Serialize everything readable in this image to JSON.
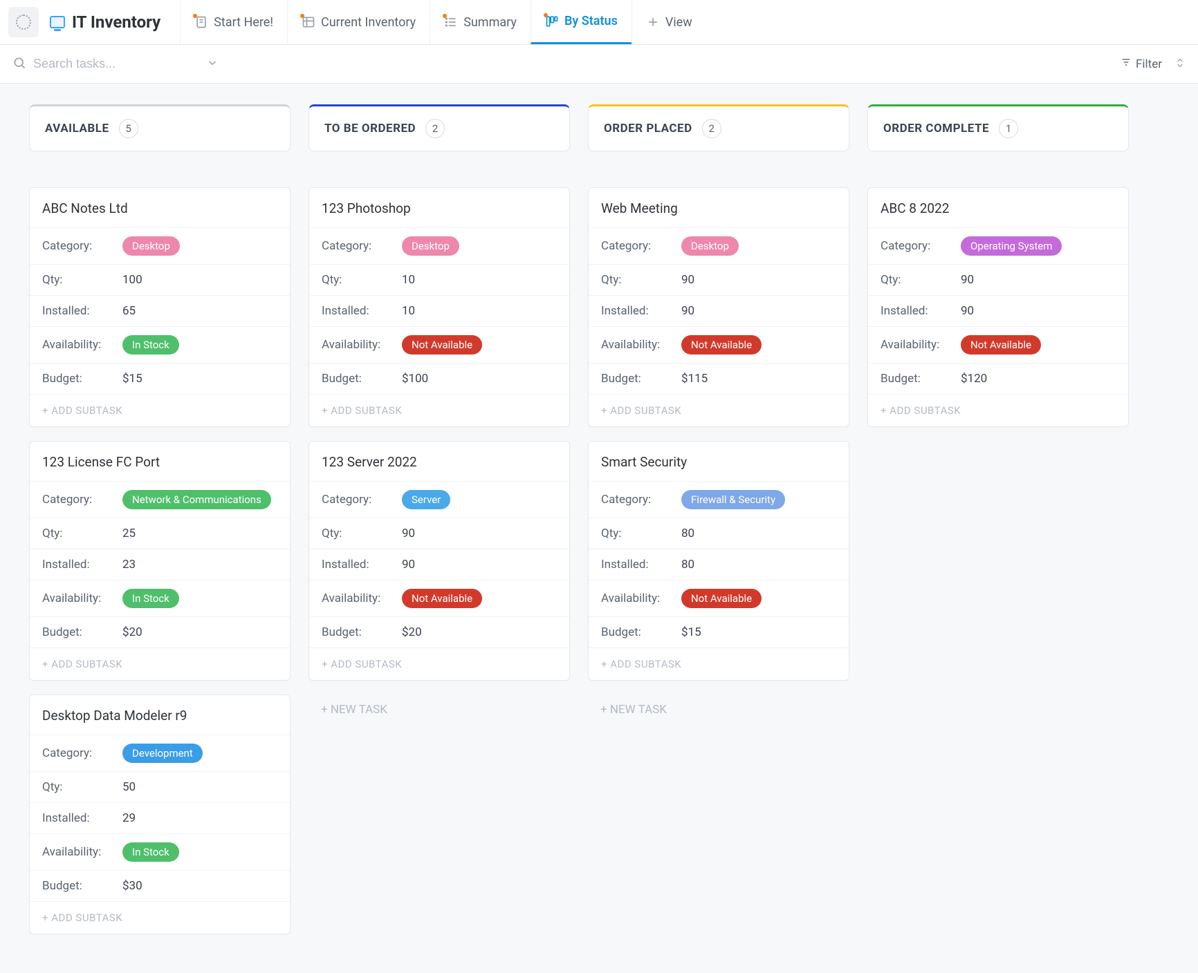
{
  "header": {
    "title": "IT Inventory",
    "tabs": [
      {
        "label": "Start Here!",
        "active": false
      },
      {
        "label": "Current Inventory",
        "active": false
      },
      {
        "label": "Summary",
        "active": false
      },
      {
        "label": "By Status",
        "active": true
      },
      {
        "label": "View",
        "active": false,
        "is_add": true
      }
    ]
  },
  "search": {
    "placeholder": "Search tasks..."
  },
  "toolbar": {
    "filter_label": "Filter"
  },
  "field_labels": {
    "category": "Category:",
    "qty": "Qty:",
    "installed": "Installed:",
    "availability": "Availability:",
    "budget": "Budget:"
  },
  "actions": {
    "add_subtask": "+ ADD SUBTASK",
    "new_task": "+ NEW TASK"
  },
  "columns": [
    {
      "title": "AVAILABLE",
      "count": "5",
      "accent": "c0",
      "show_new_task": false,
      "cards": [
        {
          "title": "ABC Notes Ltd",
          "category": "Desktop",
          "category_class": "desktop",
          "qty": "100",
          "installed": "65",
          "availability": "In Stock",
          "avail_class": "instock",
          "budget": "$15"
        },
        {
          "title": "123 License FC Port",
          "category": "Network & Communications",
          "category_class": "network",
          "qty": "25",
          "installed": "23",
          "availability": "In Stock",
          "avail_class": "instock",
          "budget": "$20"
        },
        {
          "title": "Desktop Data Modeler r9",
          "category": "Development",
          "category_class": "development",
          "qty": "50",
          "installed": "29",
          "availability": "In Stock",
          "avail_class": "instock",
          "budget": "$30"
        }
      ]
    },
    {
      "title": "TO BE ORDERED",
      "count": "2",
      "accent": "c1",
      "show_new_task": true,
      "cards": [
        {
          "title": "123 Photoshop",
          "category": "Desktop",
          "category_class": "desktop",
          "qty": "10",
          "installed": "10",
          "availability": "Not Available",
          "avail_class": "notavail",
          "budget": "$100"
        },
        {
          "title": "123 Server 2022",
          "category": "Server",
          "category_class": "server",
          "qty": "90",
          "installed": "90",
          "availability": "Not Available",
          "avail_class": "notavail",
          "budget": "$20"
        }
      ]
    },
    {
      "title": "ORDER PLACED",
      "count": "2",
      "accent": "c2",
      "show_new_task": true,
      "cards": [
        {
          "title": "Web Meeting",
          "category": "Desktop",
          "category_class": "desktop",
          "qty": "90",
          "installed": "90",
          "availability": "Not Available",
          "avail_class": "notavail",
          "budget": "$115"
        },
        {
          "title": "Smart Security",
          "category": "Firewall & Security",
          "category_class": "firewall",
          "qty": "80",
          "installed": "80",
          "availability": "Not Available",
          "avail_class": "notavail",
          "budget": "$15"
        }
      ]
    },
    {
      "title": "ORDER COMPLETE",
      "count": "1",
      "accent": "c3",
      "show_new_task": false,
      "cards": [
        {
          "title": "ABC 8 2022",
          "category": "Operating System",
          "category_class": "operating-system",
          "qty": "90",
          "installed": "90",
          "availability": "Not Available",
          "avail_class": "notavail",
          "budget": "$120"
        }
      ]
    }
  ]
}
